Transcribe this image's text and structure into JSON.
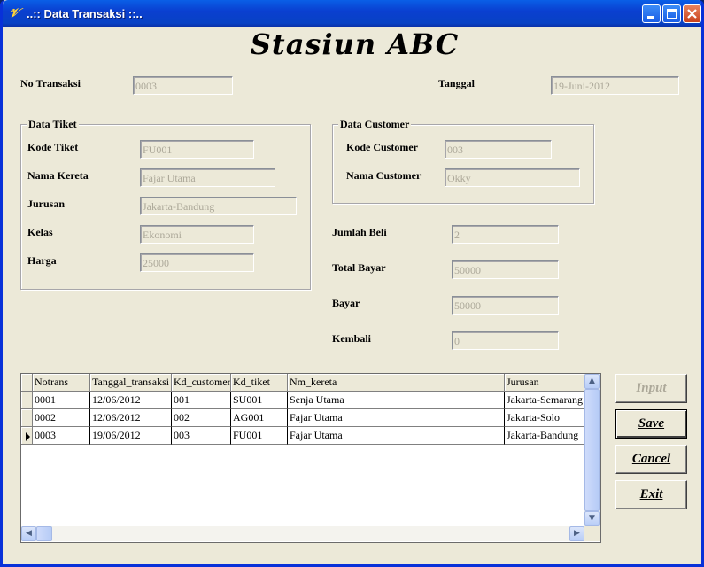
{
  "window": {
    "title": "..:: Data Transaksi ::..",
    "app_icon": "VB"
  },
  "header": {
    "brand": "Stasiun ABC"
  },
  "transaction": {
    "no_label": "No Transaksi",
    "no_value": "0003",
    "date_label": "Tanggal",
    "date_value": "19-Juni-2012"
  },
  "ticket": {
    "title": "Data Tiket",
    "code_label": "Kode Tiket",
    "code_value": "FU001",
    "train_label": "Nama Kereta",
    "train_value": "Fajar Utama",
    "route_label": "Jurusan",
    "route_value": "Jakarta-Bandung",
    "class_label": "Kelas",
    "class_value": "Ekonomi",
    "price_label": "Harga",
    "price_value": "25000"
  },
  "customer": {
    "title": "Data Customer",
    "code_label": "Kode Customer",
    "code_value": "003",
    "name_label": "Nama Customer",
    "name_value": "Okky"
  },
  "payment": {
    "qty_label": "Jumlah Beli",
    "qty_value": "2",
    "total_label": "Total Bayar",
    "total_value": "50000",
    "pay_label": "Bayar",
    "pay_value": "50000",
    "change_label": "Kembali",
    "change_value": "0"
  },
  "table": {
    "columns": [
      "Notrans",
      "Tanggal_transaksi",
      "Kd_customer",
      "Kd_tiket",
      "Nm_kereta",
      "Jurusan"
    ],
    "rows": [
      [
        "0001",
        "12/06/2012",
        "001",
        "SU001",
        "Senja Utama",
        "Jakarta-Semarang"
      ],
      [
        "0002",
        "12/06/2012",
        "002",
        "AG001",
        "Fajar Utama",
        "Jakarta-Solo"
      ],
      [
        "0003",
        "19/06/2012",
        "003",
        "FU001",
        "Fajar Utama",
        "Jakarta-Bandung"
      ]
    ],
    "current_row": 2
  },
  "actions": {
    "input": "Input",
    "save": "Save",
    "cancel": "Cancel",
    "exit": "Exit"
  },
  "colors": {
    "titlebar": "#0a3fd0",
    "face": "#ece9d8",
    "disabled_text": "#aca899"
  }
}
